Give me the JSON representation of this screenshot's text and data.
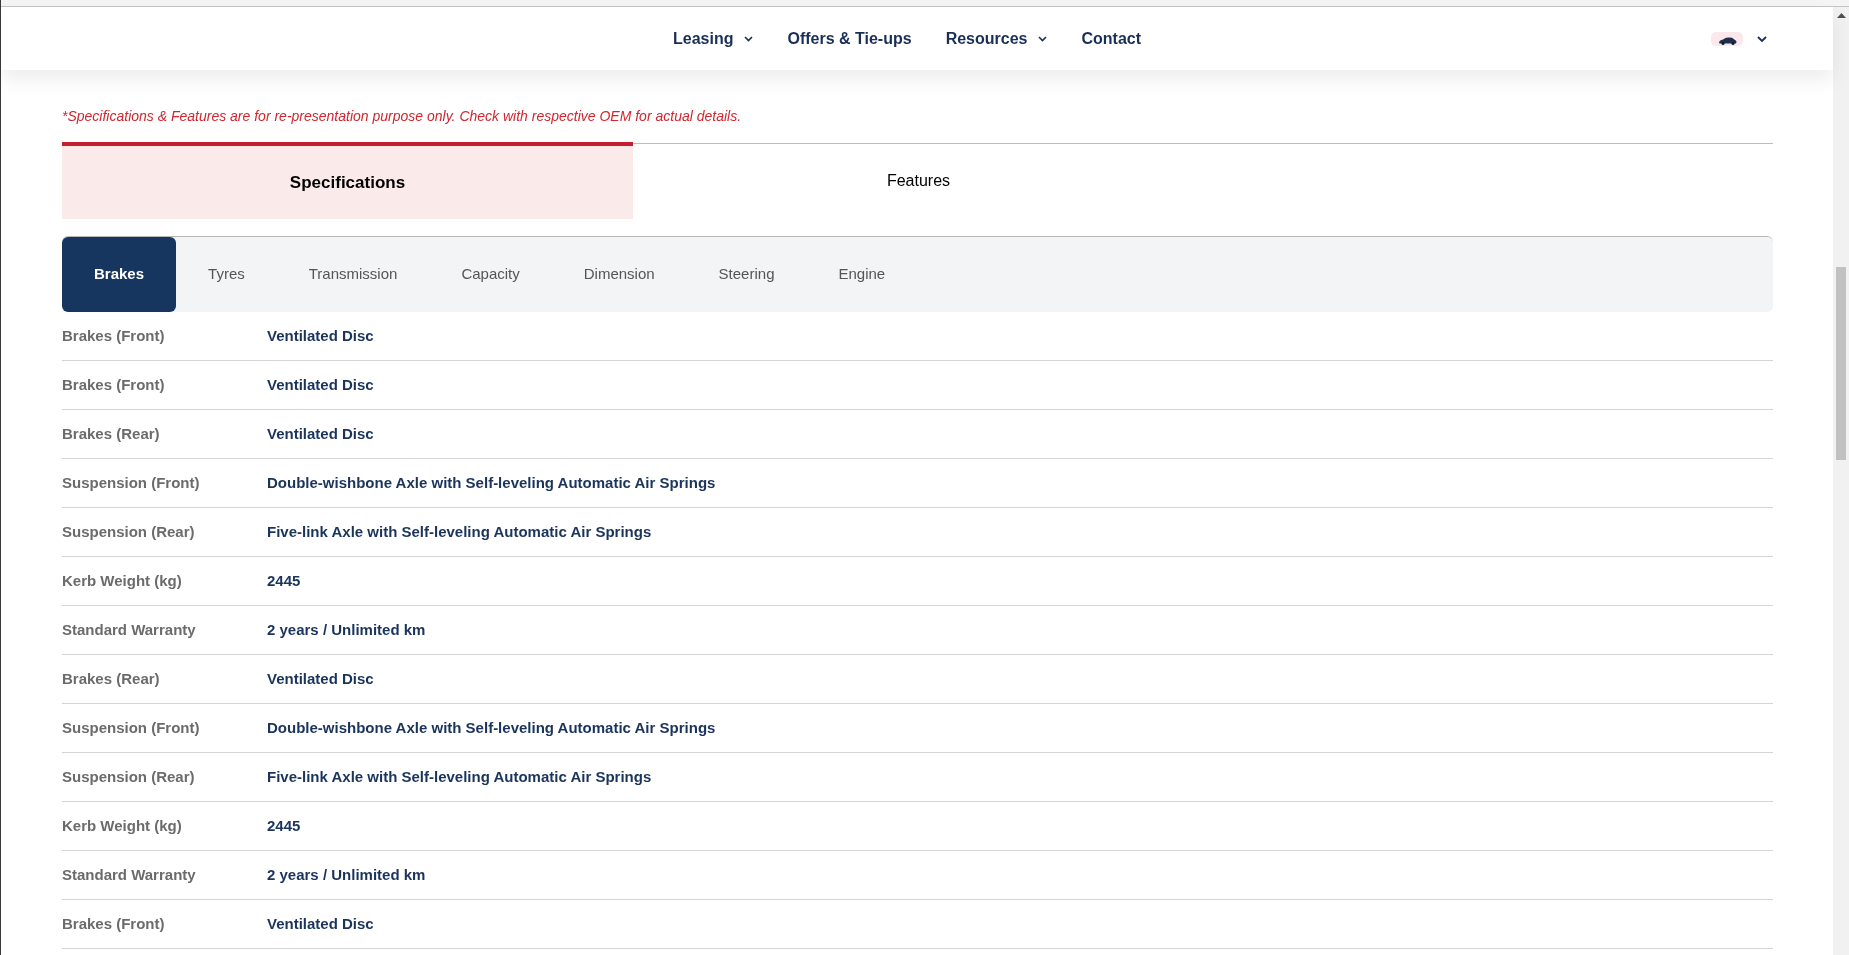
{
  "nav": [
    {
      "label": "Leasing",
      "dropdown": true
    },
    {
      "label": "Offers & Tie-ups",
      "dropdown": false
    },
    {
      "label": "Resources",
      "dropdown": true
    },
    {
      "label": "Contact",
      "dropdown": false
    }
  ],
  "disclaimer": "*Specifications & Features are for re-presentation purpose only. Check with respective OEM for actual details.",
  "main_tabs": [
    {
      "label": "Specifications",
      "selected": true
    },
    {
      "label": "Features",
      "selected": false
    }
  ],
  "spec_tabs": [
    {
      "label": "Brakes",
      "selected": true
    },
    {
      "label": "Tyres",
      "selected": false
    },
    {
      "label": "Transmission",
      "selected": false
    },
    {
      "label": "Capacity",
      "selected": false
    },
    {
      "label": "Dimension",
      "selected": false
    },
    {
      "label": "Steering",
      "selected": false
    },
    {
      "label": "Engine",
      "selected": false
    }
  ],
  "specs": {
    "rows": [
      {
        "label": "Brakes (Front)",
        "value": "Ventilated Disc"
      },
      {
        "label": "Brakes (Front)",
        "value": "Ventilated Disc"
      },
      {
        "label": "Brakes (Rear)",
        "value": "Ventilated Disc"
      },
      {
        "label": "Suspension (Front)",
        "value": "Double-wishbone Axle with Self-leveling Automatic Air Springs"
      },
      {
        "label": "Suspension (Rear)",
        "value": "Five-link Axle with Self-leveling Automatic Air Springs"
      },
      {
        "label": "Kerb Weight (kg)",
        "value": "2445"
      },
      {
        "label": "Standard Warranty",
        "value": "2 years / Unlimited km"
      },
      {
        "label": "Brakes (Rear)",
        "value": "Ventilated Disc"
      },
      {
        "label": "Suspension (Front)",
        "value": "Double-wishbone Axle with Self-leveling Automatic Air Springs"
      },
      {
        "label": "Suspension (Rear)",
        "value": "Five-link Axle with Self-leveling Automatic Air Springs"
      },
      {
        "label": "Kerb Weight (kg)",
        "value": "2445"
      },
      {
        "label": "Standard Warranty",
        "value": "2 years / Unlimited km"
      },
      {
        "label": "Brakes (Front)",
        "value": "Ventilated Disc"
      }
    ]
  }
}
